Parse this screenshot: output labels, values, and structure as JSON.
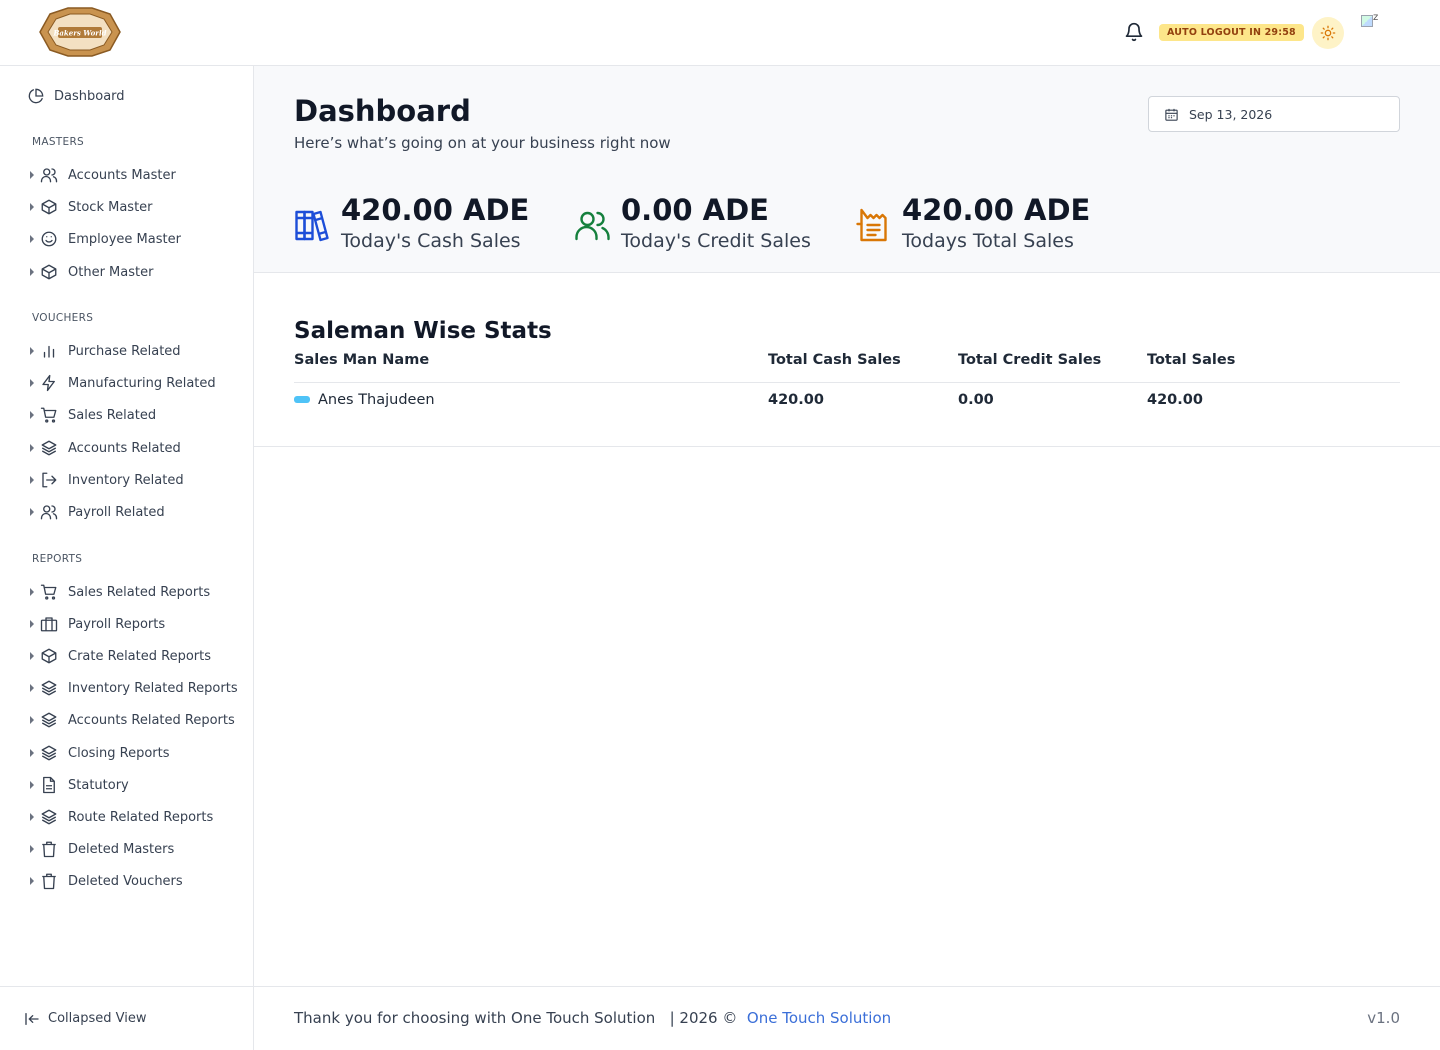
{
  "header": {
    "logo_text": "Bakers World",
    "logout_badge": "AUTO LOGOUT IN 29:58",
    "avatar_alt": "z"
  },
  "sidebar": {
    "dashboard": "Dashboard",
    "sections": {
      "masters": "MASTERS",
      "vouchers": "VOUCHERS",
      "reports": "REPORTS"
    },
    "masters": [
      {
        "label": "Accounts Master",
        "icon": "users-icon"
      },
      {
        "label": "Stock Master",
        "icon": "box-icon"
      },
      {
        "label": "Employee Master",
        "icon": "smile-icon"
      },
      {
        "label": "Other Master",
        "icon": "box-icon"
      }
    ],
    "vouchers": [
      {
        "label": "Purchase Related",
        "icon": "bar-chart-icon"
      },
      {
        "label": "Manufacturing Related",
        "icon": "bolt-icon"
      },
      {
        "label": "Sales Related",
        "icon": "cart-icon"
      },
      {
        "label": "Accounts Related",
        "icon": "layers-icon"
      },
      {
        "label": "Inventory Related",
        "icon": "logout-icon"
      },
      {
        "label": "Payroll Related",
        "icon": "users-icon"
      }
    ],
    "reports": [
      {
        "label": "Sales Related Reports",
        "icon": "cart-icon"
      },
      {
        "label": "Payroll Reports",
        "icon": "briefcase-icon"
      },
      {
        "label": "Crate Related Reports",
        "icon": "box-icon"
      },
      {
        "label": "Inventory Related Reports",
        "icon": "layers-icon"
      },
      {
        "label": "Accounts Related Reports",
        "icon": "layers-icon"
      },
      {
        "label": "Closing Reports",
        "icon": "layers-icon"
      },
      {
        "label": "Statutory",
        "icon": "file-icon"
      },
      {
        "label": "Route Related Reports",
        "icon": "layers-icon"
      },
      {
        "label": "Deleted Masters",
        "icon": "trash-icon"
      },
      {
        "label": "Deleted Vouchers",
        "icon": "trash-icon"
      }
    ],
    "collapse_label": "Collapsed View"
  },
  "main": {
    "title": "Dashboard",
    "subtitle": "Here’s what’s going on at your business right now",
    "date": "Sep 13, 2026",
    "stats": [
      {
        "value": "420.00 ADE",
        "label": "Today's Cash Sales",
        "color": "#1d4ed8",
        "icon": "books-icon"
      },
      {
        "value": "0.00 ADE",
        "label": "Today's Credit Sales",
        "color": "#15803d",
        "icon": "users-icon"
      },
      {
        "value": "420.00 ADE",
        "label": "Todays Total Sales",
        "color": "#d97706",
        "icon": "receipt-icon"
      }
    ],
    "salesman_title": "Saleman Wise Stats",
    "table": {
      "headers": [
        "Sales Man Name",
        "Total Cash Sales",
        "Total Credit Sales",
        "Total Sales"
      ],
      "rows": [
        {
          "name": "Anes Thajudeen",
          "cash": "420.00",
          "credit": "0.00",
          "total": "420.00"
        }
      ]
    }
  },
  "footer": {
    "thanks": "Thank you for choosing with One Touch Solution",
    "year": "|  2026 ©",
    "company": "One Touch Solution",
    "version": "v1.0"
  }
}
